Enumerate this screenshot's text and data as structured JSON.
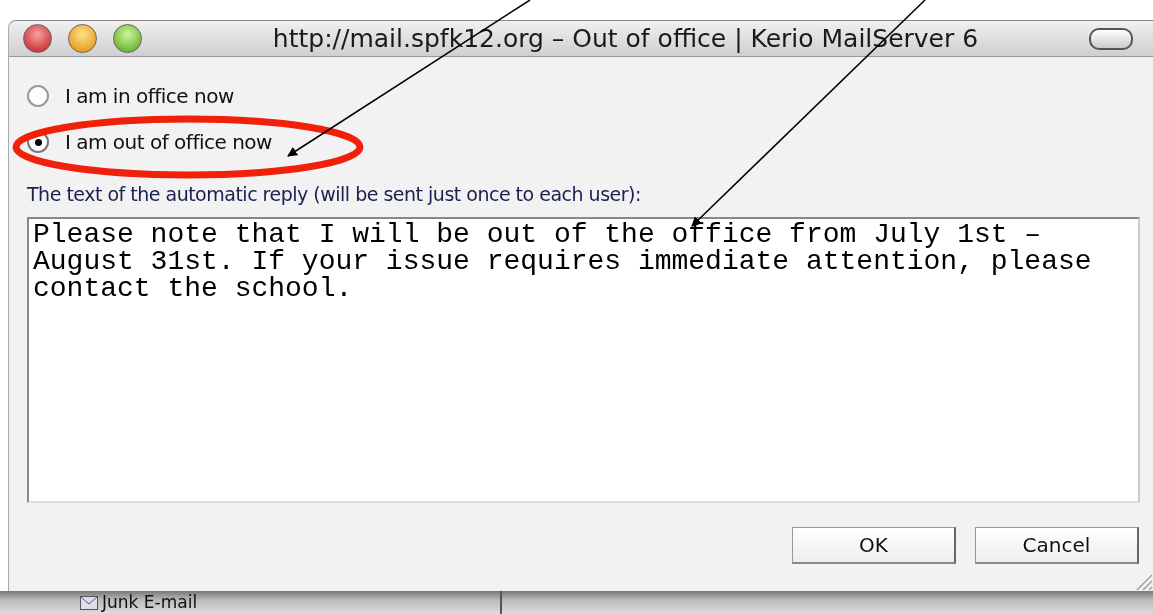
{
  "window": {
    "title": "http://mail.spfk12.org – Out of office | Kerio MailServer 6"
  },
  "options": [
    {
      "label": "I am in office now",
      "selected": false
    },
    {
      "label": "I am out of office now",
      "selected": true
    }
  ],
  "reply_label": "The text of the automatic reply (will be sent just once to each user):",
  "reply_text": "Please note that I will be out of the office from July 1st – August 31st. If your issue requires immediate attention, please contact the school.",
  "buttons": [
    "OK",
    "Cancel"
  ],
  "background": {
    "folder": "Junk E-mail"
  }
}
